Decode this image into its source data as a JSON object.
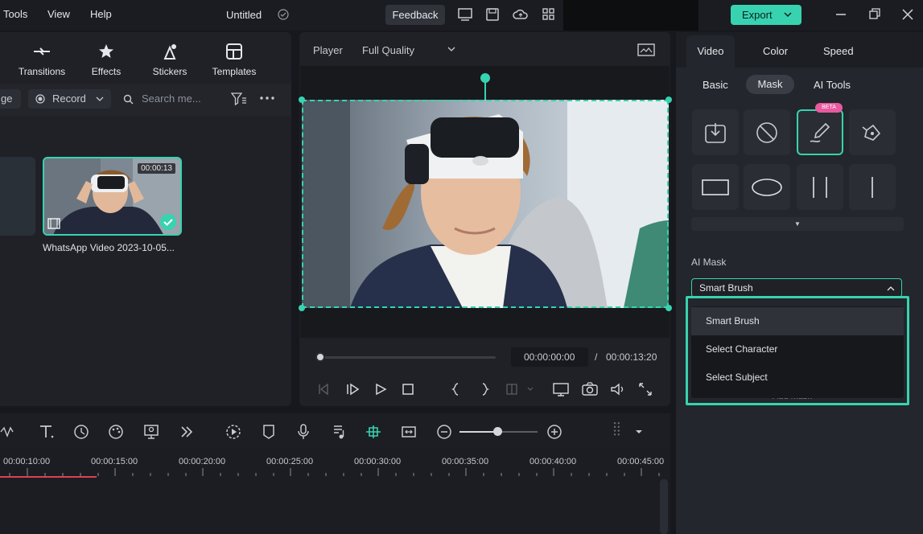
{
  "menu": {
    "tools": "Tools",
    "view": "View",
    "help": "Help"
  },
  "project_title": "Untitled",
  "feedback_label": "Feedback",
  "export_label": "Export",
  "media_toolbar": {
    "transitions": "Transitions",
    "effects": "Effects",
    "stickers": "Stickers",
    "templates": "Templates"
  },
  "media_bar": {
    "left_cut_label": "ge",
    "record_label": "Record",
    "search_placeholder": "Search me..."
  },
  "clip": {
    "duration": "00:00:13",
    "name": "WhatsApp Video 2023-10-05..."
  },
  "player": {
    "label": "Player",
    "quality": "Full Quality",
    "current_time": "00:00:00:00",
    "separator": "/",
    "total_time": "00:00:13:20"
  },
  "right_panel": {
    "tabs": [
      "Video",
      "Color",
      "Speed"
    ],
    "subtabs": [
      "Basic",
      "Mask",
      "AI Tools"
    ],
    "beta_badge": "BETA",
    "ai_mask_label": "AI Mask",
    "selected_option": "Smart Brush",
    "options": [
      "Smart Brush",
      "Select Character",
      "Select Subject"
    ],
    "hidden_button": "Add Mask"
  },
  "timeline": {
    "ticks": [
      "00:00:10:00",
      "00:00:15:00",
      "00:00:20:00",
      "00:00:25:00",
      "00:00:30:00",
      "00:00:35:00",
      "00:00:40:00",
      "00:00:45:00"
    ]
  },
  "colors": {
    "accent": "#37d3b0",
    "playhead": "#e0414f",
    "beta": "#e85aa0"
  }
}
